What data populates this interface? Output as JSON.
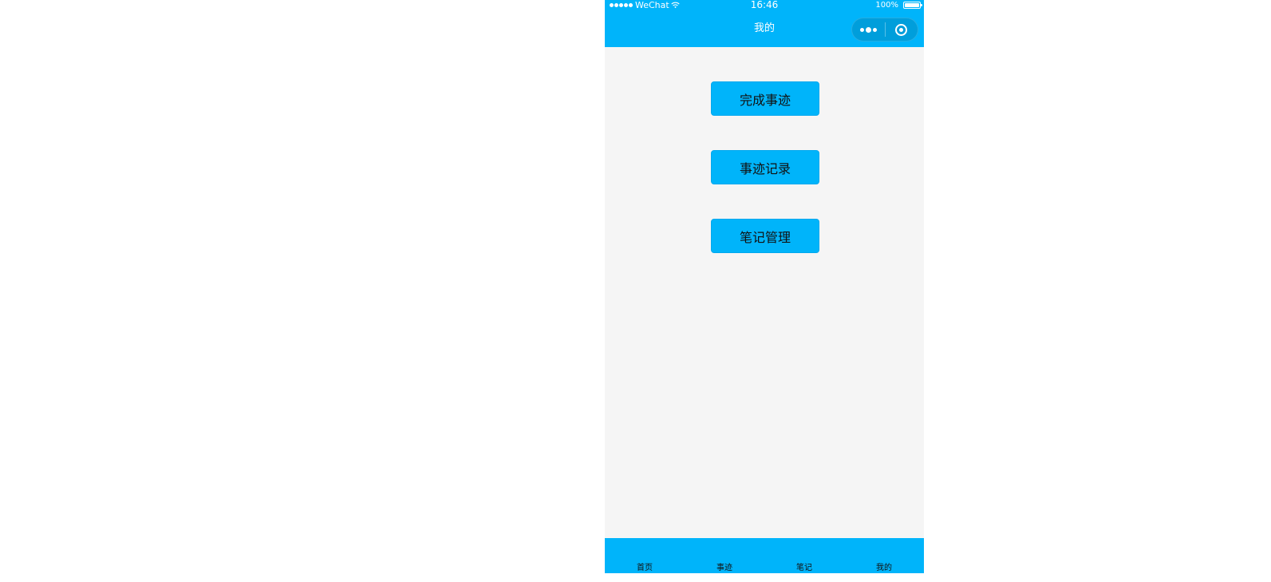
{
  "status_bar": {
    "carrier": "WeChat",
    "time": "16:46",
    "battery": "100%"
  },
  "nav_bar": {
    "title": "我的"
  },
  "menu": {
    "buttons": [
      {
        "label": "完成事迹"
      },
      {
        "label": "事迹记录"
      },
      {
        "label": "笔记管理"
      }
    ]
  },
  "tab_bar": {
    "items": [
      {
        "label": "首页"
      },
      {
        "label": "事迹"
      },
      {
        "label": "笔记"
      },
      {
        "label": "我的"
      }
    ]
  },
  "colors": {
    "primary": "#00b4fa",
    "background": "#f5f5f5"
  }
}
